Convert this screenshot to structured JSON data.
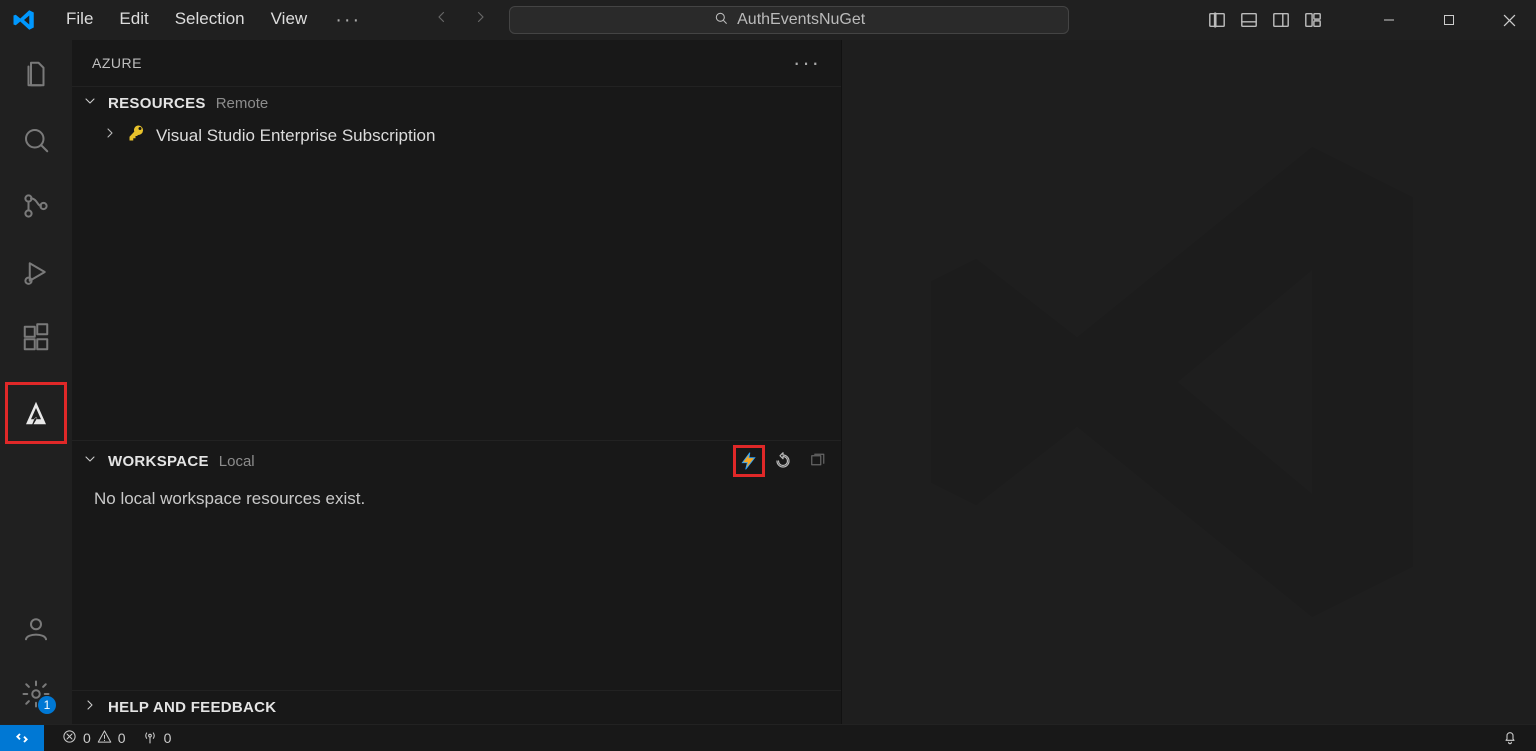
{
  "titlebar": {
    "menu": [
      "File",
      "Edit",
      "Selection",
      "View"
    ],
    "search_text": "AuthEventsNuGet"
  },
  "activitybar": {
    "badge": "1"
  },
  "sidebar": {
    "title": "AZURE",
    "resources": {
      "name": "RESOURCES",
      "sub": "Remote",
      "items": [
        {
          "label": "Visual Studio Enterprise Subscription"
        }
      ]
    },
    "workspace": {
      "name": "WORKSPACE",
      "sub": "Local",
      "empty_text": "No local workspace resources exist."
    },
    "help": {
      "name": "HELP AND FEEDBACK"
    }
  },
  "statusbar": {
    "errors": "0",
    "warnings": "0",
    "ports": "0"
  }
}
